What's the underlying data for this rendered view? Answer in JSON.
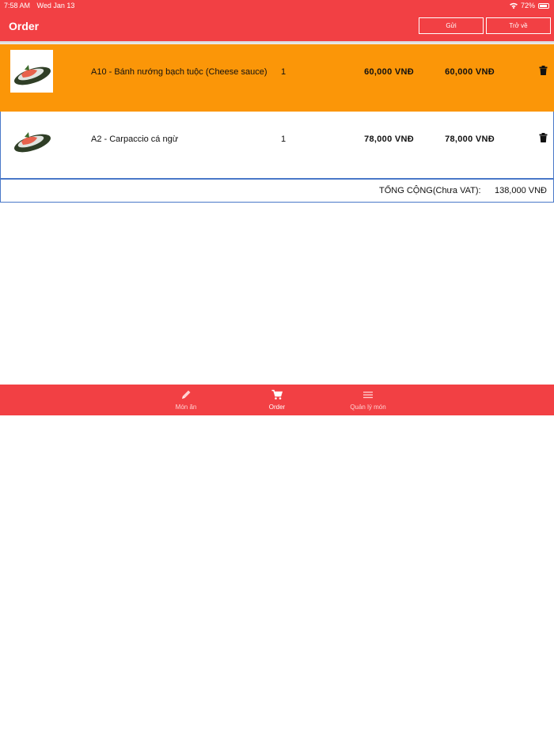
{
  "status_bar": {
    "time": "7:58 AM",
    "date": "Wed Jan 13",
    "battery": "72%"
  },
  "header": {
    "title": "Order",
    "send_label": "Gửi",
    "back_label": "Trở về"
  },
  "order_items": [
    {
      "name": "A10 - Bánh nướng bạch tuộc (Cheese sauce)",
      "qty": "1",
      "price": "60,000 VNĐ",
      "total": "60,000 VNĐ"
    },
    {
      "name": "A2 - Carpaccio cá ngừ",
      "qty": "1",
      "price": "78,000 VNĐ",
      "total": "78,000 VNĐ"
    }
  ],
  "summary": {
    "label": "TỔNG CỘNG(Chưa VAT):",
    "value": "138,000 VNĐ"
  },
  "tabs": [
    {
      "label": "Món ăn",
      "icon": "pencil-icon"
    },
    {
      "label": "Order",
      "icon": "cart-icon"
    },
    {
      "label": "Quản lý món",
      "icon": "menu-icon"
    }
  ],
  "colors": {
    "accent": "#f24044",
    "selected_row": "#fb9608",
    "row_border": "#4a78c8"
  }
}
